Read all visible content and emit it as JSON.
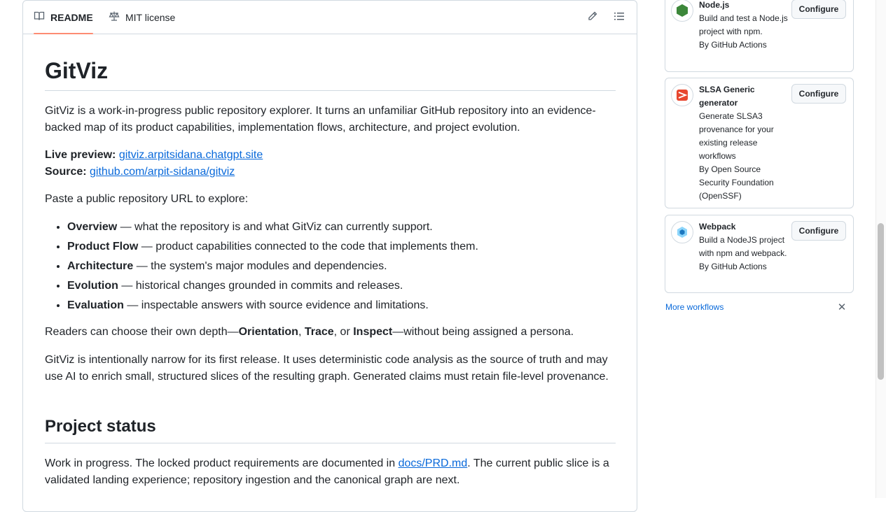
{
  "readme": {
    "tabs": {
      "readme": "README",
      "license": "MIT license"
    },
    "title": "GitViz",
    "intro": "GitViz is a work-in-progress public repository explorer. It turns an unfamiliar GitHub repository into an evidence-backed map of its product capabilities, implementation flows, architecture, and project evolution.",
    "live_label": "Live preview:",
    "live_link": "gitviz.arpitsidana.chatgpt.site",
    "source_label": "Source:",
    "source_link": "github.com/arpit-sidana/gitviz",
    "paste": "Paste a public repository URL to explore:",
    "features": [
      {
        "name": "Overview",
        "desc": " — what the repository is and what GitViz can currently support."
      },
      {
        "name": "Product Flow",
        "desc": " — product capabilities connected to the code that implements them."
      },
      {
        "name": "Architecture",
        "desc": " — the system's major modules and dependencies."
      },
      {
        "name": "Evolution",
        "desc": " — historical changes grounded in commits and releases."
      },
      {
        "name": "Evaluation",
        "desc": " — inspectable answers with source evidence and limitations."
      }
    ],
    "depth": {
      "pre": "Readers can choose their own depth—",
      "a": "Orientation",
      "sep1": ", ",
      "b": "Trace",
      "sep2": ", or ",
      "c": "Inspect",
      "post": "—without being assigned a persona."
    },
    "narrow": "GitViz is intentionally narrow for its first release. It uses deterministic code analysis as the source of truth and may use AI to enrich small, structured slices of the resulting graph. Generated claims must retain file-level provenance.",
    "status_heading": "Project status",
    "status": {
      "pre": "Work in progress. The locked product requirements are documented in ",
      "link": "docs/PRD.md",
      "post": ". The current public slice is a validated landing experience; repository ingestion and the canonical graph are next."
    }
  },
  "workflows": [
    {
      "title": "Node.js",
      "desc": "Build and test a Node.js project with npm.",
      "by": "By GitHub Actions",
      "button": "Configure",
      "icon": "nodejs-icon",
      "color": "#3c873a"
    },
    {
      "title": "SLSA Generic generator",
      "desc": "Generate SLSA3 provenance for your existing release workflows",
      "by": "By Open Source Security Foundation (OpenSSF)",
      "button": "Configure",
      "icon": "slsa-icon",
      "color": "#e8472f"
    },
    {
      "title": "Webpack",
      "desc": "Build a NodeJS project with npm and webpack.",
      "by": "By GitHub Actions",
      "button": "Configure",
      "icon": "webpack-icon",
      "color": "#1c78c0"
    }
  ],
  "more_workflows": "More workflows",
  "close_glyph": "✕"
}
